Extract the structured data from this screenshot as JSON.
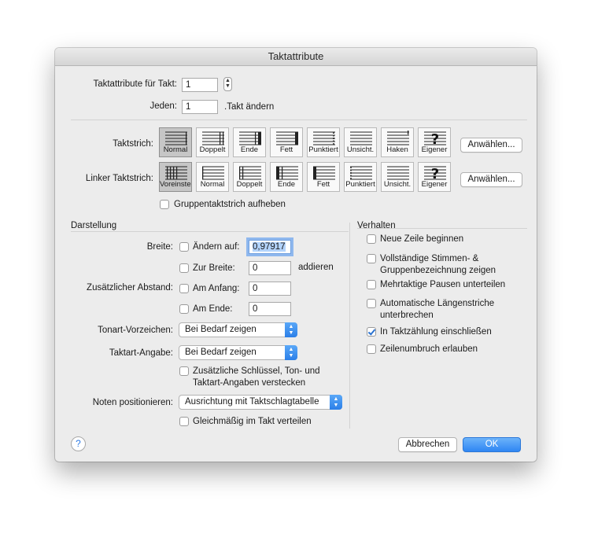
{
  "window": {
    "title": "Taktattribute"
  },
  "top": {
    "attr_label": "Taktattribute für Takt:",
    "attr_value": "1",
    "every_label": "Jeden:",
    "every_value": "1",
    "every_suffix": ".Takt ändern"
  },
  "barline": {
    "label": "Taktstrich:",
    "selected": "Normal",
    "options": [
      {
        "label": "Normal",
        "icon": "barline-normal-icon"
      },
      {
        "label": "Doppelt",
        "icon": "barline-double-icon"
      },
      {
        "label": "Ende",
        "icon": "barline-final-icon"
      },
      {
        "label": "Fett",
        "icon": "barline-thick-icon"
      },
      {
        "label": "Punktiert",
        "icon": "barline-dotted-icon"
      },
      {
        "label": "Unsicht.",
        "icon": "barline-invisible-icon"
      },
      {
        "label": "Haken",
        "icon": "barline-tick-icon"
      },
      {
        "label": "Eigener",
        "icon": "barline-custom-icon"
      }
    ],
    "select_button": "Anwählen..."
  },
  "left_barline": {
    "label": "Linker Taktstrich:",
    "selected": "Voreinstellung",
    "options": [
      {
        "label": "Voreinstellung",
        "icon": "left-barline-default-icon"
      },
      {
        "label": "Normal",
        "icon": "left-barline-normal-icon"
      },
      {
        "label": "Doppelt",
        "icon": "left-barline-double-icon"
      },
      {
        "label": "Ende",
        "icon": "left-barline-final-icon"
      },
      {
        "label": "Fett",
        "icon": "left-barline-thick-icon"
      },
      {
        "label": "Punktiert",
        "icon": "left-barline-dotted-icon"
      },
      {
        "label": "Unsicht.",
        "icon": "left-barline-invisible-icon"
      },
      {
        "label": "Eigener",
        "icon": "left-barline-custom-icon"
      }
    ],
    "select_button": "Anwählen...",
    "group_barline_checkbox": "Gruppentaktstrich aufheben",
    "group_barline_checked": false
  },
  "darstellung": {
    "header": "Darstellung",
    "width_label": "Breite:",
    "change_to": {
      "label": "Ändern auf:",
      "checked": false,
      "value": "0,97917"
    },
    "add_width": {
      "label": "Zur Breite:",
      "checked": false,
      "value": "0",
      "suffix": "addieren"
    },
    "extra_space_label": "Zusätzlicher Abstand:",
    "at_start": {
      "label": "Am Anfang:",
      "checked": false,
      "value": "0"
    },
    "at_end": {
      "label": "Am Ende:",
      "checked": false,
      "value": "0"
    },
    "key_sig": {
      "label": "Tonart-Vorzeichen:",
      "value": "Bei Bedarf zeigen"
    },
    "time_sig": {
      "label": "Taktart-Angabe:",
      "value": "Bei Bedarf zeigen"
    },
    "hide_extra": {
      "line1": "Zusätzliche Schlüssel, Ton- und",
      "line2": "Taktart-Angaben verstecken",
      "checked": false
    },
    "position_notes": {
      "label": "Noten positionieren:",
      "value": "Ausrichtung mit Taktschlagtabelle"
    },
    "distribute": {
      "label": "Gleichmäßig im Takt verteilen",
      "checked": false
    }
  },
  "verhalten": {
    "header": "Verhalten",
    "items": [
      {
        "line1": "Neue Zeile beginnen",
        "line2": "",
        "checked": false
      },
      {
        "line1": "Vollständige Stimmen- &",
        "line2": "Gruppenbezeichnung zeigen",
        "checked": false
      },
      {
        "line1": "Mehrtaktige Pausen unterteilen",
        "line2": "",
        "checked": false
      },
      {
        "line1": "Automatische Längenstriche",
        "line2": "unterbrechen",
        "checked": false
      },
      {
        "line1": "In Taktzählung einschließen",
        "line2": "",
        "checked": true
      },
      {
        "line1": "Zeilenumbruch erlauben",
        "line2": "",
        "checked": false
      }
    ]
  },
  "footer": {
    "help": "?",
    "cancel": "Abbrechen",
    "ok": "OK"
  }
}
